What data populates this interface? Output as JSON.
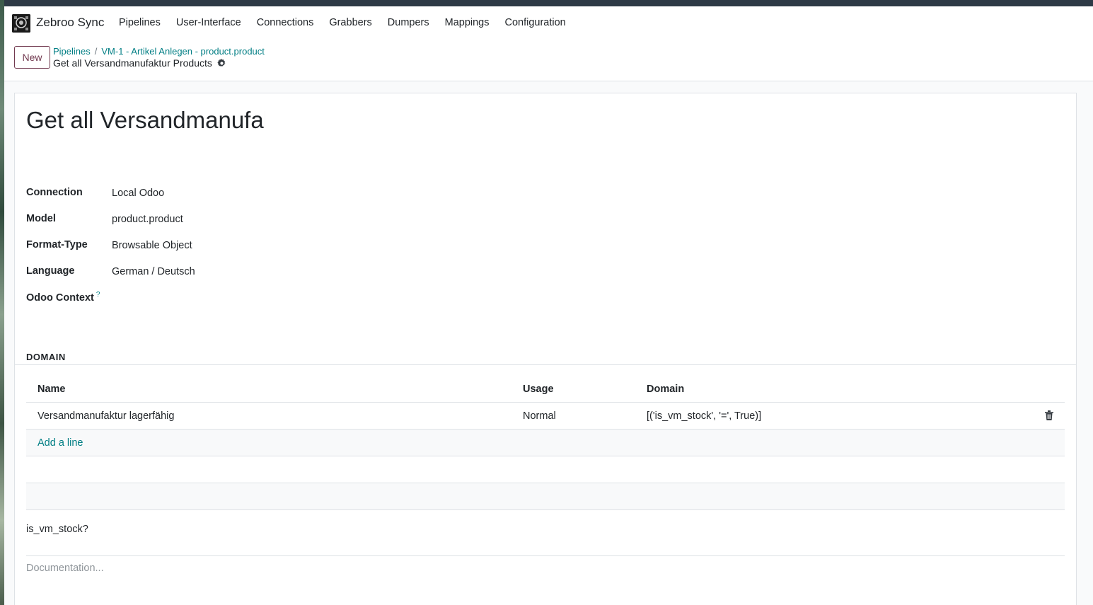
{
  "navbar": {
    "brand": "Zebroo Sync",
    "menu": [
      "Pipelines",
      "User-Interface",
      "Connections",
      "Grabbers",
      "Dumpers",
      "Mappings",
      "Configuration"
    ]
  },
  "control_panel": {
    "new_label": "New",
    "breadcrumb": [
      "Pipelines",
      "VM-1 - Artikel Anlegen - product.product"
    ],
    "breadcrumb_separator": "/",
    "current": "Get all Versandmanufaktur Products"
  },
  "form": {
    "title": "Get all Versandmanufaktur Products",
    "fields": [
      {
        "label": "Connection",
        "value": "Local Odoo"
      },
      {
        "label": "Model",
        "value": "product.product"
      },
      {
        "label": "Format-Type",
        "value": "Browsable Object"
      },
      {
        "label": "Language",
        "value": "German / Deutsch"
      },
      {
        "label": "Odoo Context",
        "value": "",
        "help": "?"
      }
    ],
    "section_title": "DOMAIN",
    "table": {
      "headers": [
        "Name",
        "Usage",
        "Domain"
      ],
      "rows": [
        {
          "name": "Versandmanufaktur lagerfähig",
          "usage": "Normal",
          "domain": "[('is_vm_stock', '=', True)]"
        }
      ],
      "add_line": "Add a line"
    },
    "note": "is_vm_stock?",
    "documentation_placeholder": "Documentation..."
  },
  "colors": {
    "accent": "#017e84",
    "brand_primary": "#71394f",
    "topbar": "#2e3a46"
  }
}
